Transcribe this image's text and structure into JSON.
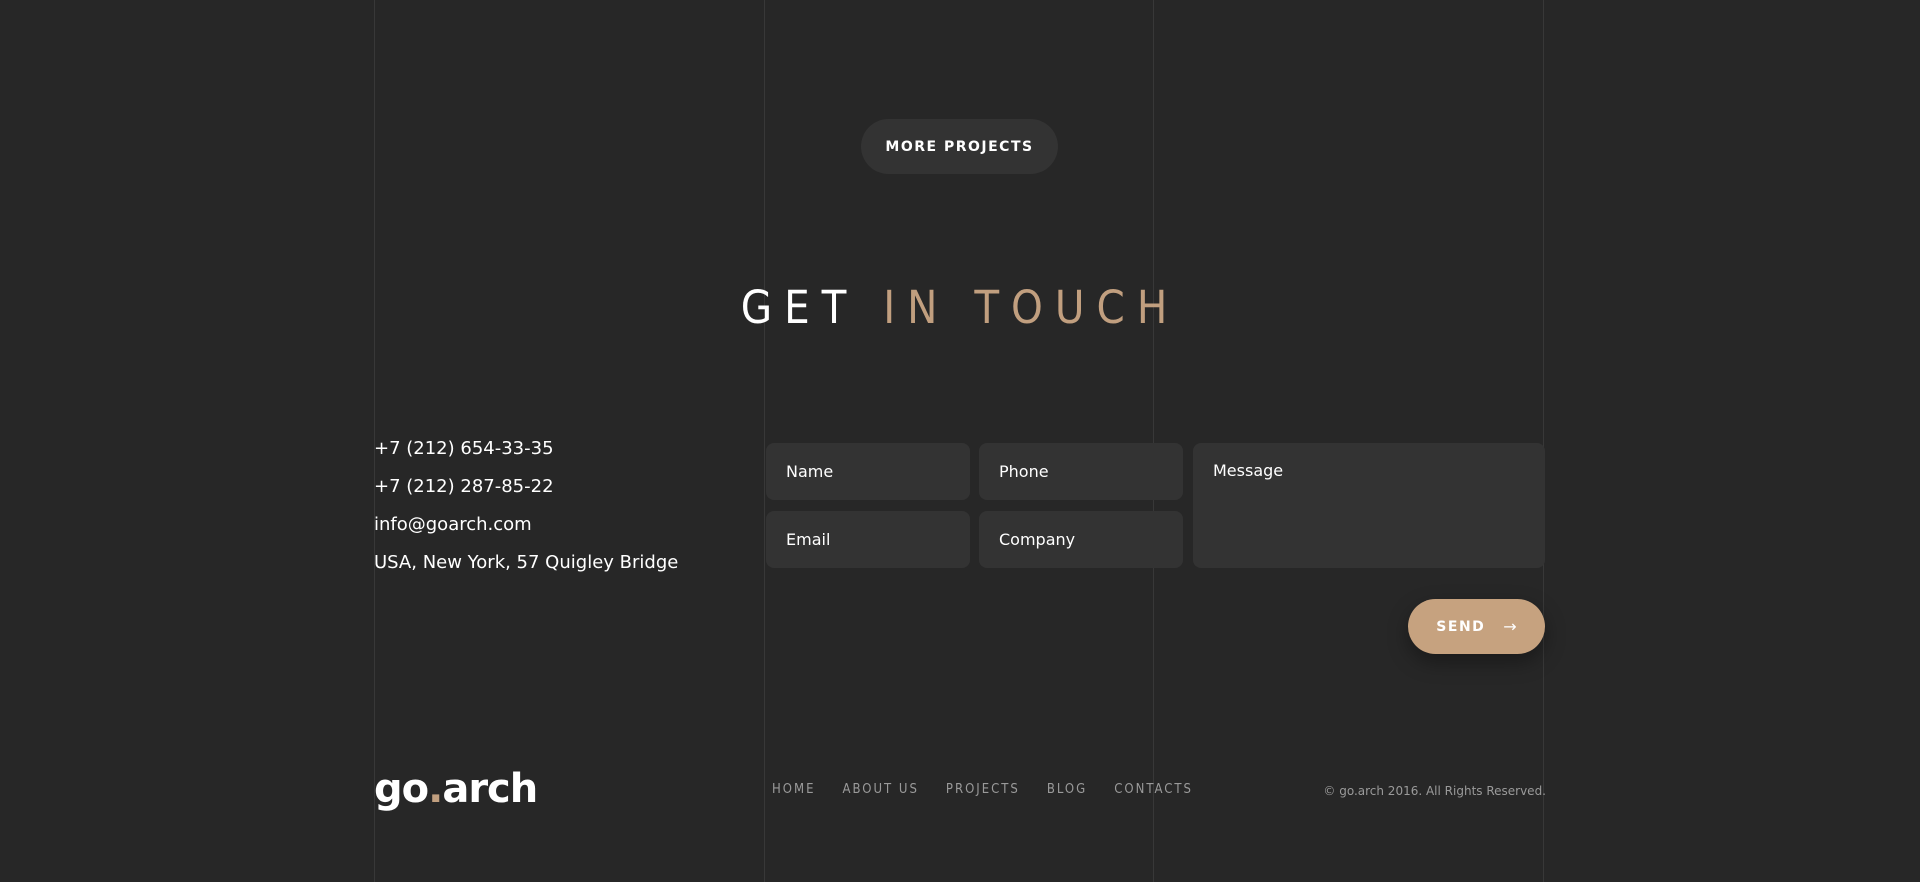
{
  "more_projects": {
    "label": "MORE PROJECTS"
  },
  "contact_section": {
    "heading_part1": "GET",
    "heading_part2": "IN TOUCH",
    "phone_1": "+7 (212) 654-33-35",
    "phone_2": "+7 (212) 287-85-22",
    "email": "info@goarch.com",
    "address": "USA, New York, 57 Quigley Bridge"
  },
  "form": {
    "name_placeholder": "Name",
    "phone_placeholder": "Phone",
    "email_placeholder": "Email",
    "company_placeholder": "Company",
    "message_placeholder": "Message",
    "send_label": "SEND",
    "send_icon": "arrow-right-icon"
  },
  "footer": {
    "logo_part1": "go",
    "logo_dot": ".",
    "logo_part2": "arch",
    "nav": [
      {
        "label": "HOME"
      },
      {
        "label": "ABOUT US"
      },
      {
        "label": "PROJECTS"
      },
      {
        "label": "BLOG"
      },
      {
        "label": "CONTACTS"
      }
    ],
    "copyright": "© go.arch 2016. All Rights Reserved."
  },
  "colors": {
    "background": "#272727",
    "accent": "#c19f7f",
    "field_background": "#333333",
    "send_button": "#c6a27f"
  }
}
